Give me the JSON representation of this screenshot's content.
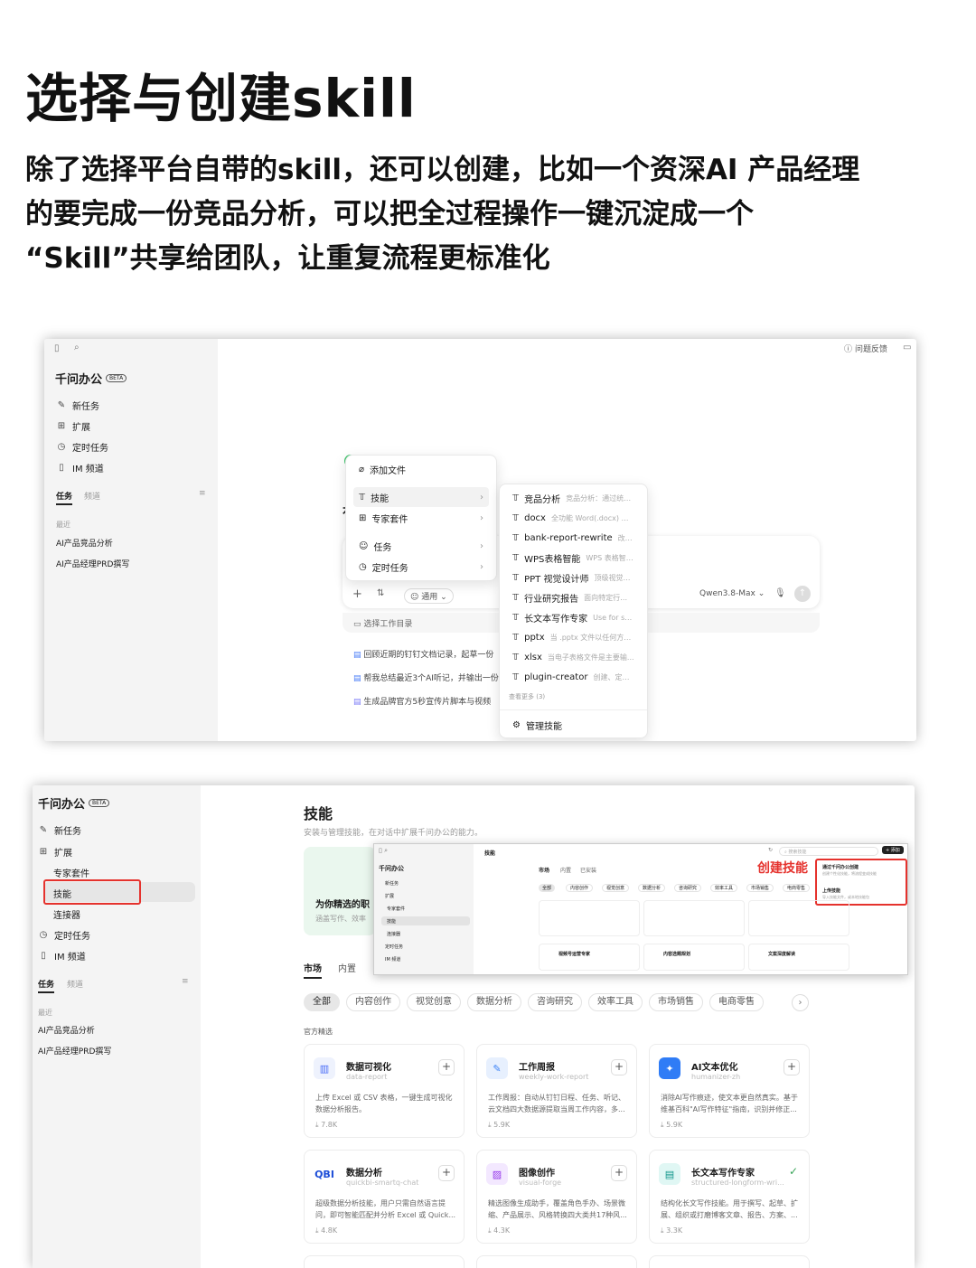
{
  "headline": "选择与创建skill",
  "subtext": [
    "除了选择平台自带的skill，还可以创建，比如一个资深AI 产品经理",
    "的要完成一份竞品分析，可以把全过程操作一键沉淀成一个",
    "“Skill”共享给团队，让重复流程更标准化"
  ],
  "shot1": {
    "brand": "千问办公",
    "beta": "BETA",
    "feedback": "问题反馈",
    "nav": [
      "新任务",
      "扩展",
      "定时任务",
      "IM 频道"
    ],
    "tabs": [
      "任务",
      "频道"
    ],
    "recent_label": "最近",
    "recent": [
      "AI产品竞品分析",
      "AI产品经理PRD撰写"
    ],
    "menu1": [
      "添加文件",
      "技能",
      "专家套件",
      "任务",
      "定时任务"
    ],
    "skills": [
      {
        "name": "竞品分析",
        "desc": "竞品分析：通过统一..."
      },
      {
        "name": "docx",
        "desc": "全功能 Word(.docx) 技..."
      },
      {
        "name": "bank-report-rewrite",
        "desc": "改写银..."
      },
      {
        "name": "WPS表格智能",
        "desc": "WPS 表格智能..."
      },
      {
        "name": "PPT 视觉设计师",
        "desc": "顶级视觉策..."
      },
      {
        "name": "行业研究报告",
        "desc": "面向特定行业/..."
      },
      {
        "name": "长文本写作专家",
        "desc": "Use for stru..."
      },
      {
        "name": "pptx",
        "desc": "当 .pptx 文件以任何方式..."
      },
      {
        "name": "xlsx",
        "desc": "当电子表格文件是主要输..."
      },
      {
        "name": "plugin-creator",
        "desc": "创建、定制或..."
      }
    ],
    "more": "查看更多 (3)",
    "manage": "管理技能",
    "toolbar_general": "通用",
    "model": "Qwen3.8-Max",
    "workdir": "选择工作目录",
    "suggestions": [
      "回顾近期的钉钉文档记录，起草一份",
      "帮我总结最近3个AI听记，并输出一份",
      "生成品牌官方5秒宣传片脚本与视频"
    ]
  },
  "shot2": {
    "brand": "千问办公",
    "beta": "BETA",
    "nav": [
      "新任务",
      "扩展",
      "专家套件",
      "技能",
      "连接器",
      "定时任务",
      "IM 频道"
    ],
    "tabs": [
      "任务",
      "频道"
    ],
    "recent_label": "最近",
    "recent": [
      "AI产品竞品分析",
      "AI产品经理PRD撰写"
    ],
    "title": "技能",
    "subtitle": "安装与管理技能，在对话中扩展千问办公的能力。",
    "banner_title": "为你精选的职",
    "banner_sub": "涵盖写作、效率",
    "market_tabs": [
      "市场",
      "内置"
    ],
    "categories": [
      "全部",
      "内容创作",
      "视觉创意",
      "数据分析",
      "咨询研究",
      "效率工具",
      "市场销售",
      "电商零售"
    ],
    "section": "官方精选",
    "cards": [
      {
        "icon": "chart",
        "title": "数据可视化",
        "slug": "data-report",
        "desc": "上传 Excel 或 CSV 表格，一键生成可视化数据分析报告。",
        "dl": "7.8K",
        "color": "#e9eefc",
        "fg": "#4a6cf7",
        "glyph": "📊"
      },
      {
        "icon": "weekly",
        "title": "工作周报",
        "slug": "weekly-work-report",
        "desc": "工作周报：自动从钉钉日程、任务、听记、云文档四大数据源提取当周工作内容，多...",
        "dl": "5.9K",
        "color": "#e7f0fe",
        "fg": "#3b82f6",
        "glyph": "✎"
      },
      {
        "icon": "ai-write",
        "title": "AI文本优化",
        "slug": "humanizer-zh",
        "desc": "消除AI写作痕迹，使文本更自然真实。基于维基百科\"AI写作特征\"指南，识别并修正...",
        "dl": "5.9K",
        "color": "#e6f0ff",
        "fg": "#2563eb",
        "glyph": "✦"
      },
      {
        "icon": "qbi",
        "title": "数据分析",
        "slug": "quickbi-smartq-chat",
        "desc": "超级数据分析技能，用户只需自然语言提问，即可智能匹配并分析 Excel 或 Quick...",
        "dl": "4.8K",
        "color": "#ffffff",
        "fg": "#1d4ed8",
        "glyph": "QBI"
      },
      {
        "icon": "image",
        "title": "图像创作",
        "slug": "visual-forge",
        "desc": "精选图像生成助手，覆盖角色手办、场景微缩、产品展示、风格转换四大类共17种风...",
        "dl": "4.3K",
        "color": "#f3e8ff",
        "fg": "#9333ea",
        "glyph": "▨"
      },
      {
        "icon": "longform",
        "title": "长文本写作专家",
        "slug": "structured-longform-wri...",
        "desc": "结构化长文写作技能。用于撰写、起草、扩展、组织或打磨博客文章、报告、方案、...",
        "dl": "3.3K",
        "color": "#e0f7f4",
        "fg": "#0d9488",
        "glyph": "▤"
      }
    ],
    "inset": {
      "brand": "千问办公",
      "page": "技能",
      "tabs": [
        "市场",
        "内置",
        "已安装"
      ],
      "nav": [
        "新任务",
        "扩展",
        "专家套件",
        "技能",
        "连接器",
        "定时任务",
        "IM 频道"
      ],
      "create_label": "创建技能",
      "add_btn": "+ 添加",
      "search": "搜索技能",
      "chips": [
        "全部",
        "内容创作",
        "视觉创意",
        "数据分析",
        "咨询研究",
        "效率工具",
        "市场销售",
        "电商零售"
      ],
      "dropdown": [
        {
          "t": "通过千问办公创建",
          "s": "创建个性化技能，将流程变成技能"
        },
        {
          "t": "上传技能",
          "s": "导入技能文件，或本地技能包"
        }
      ],
      "cards": [
        "视频号运营专家",
        "内容选题规划",
        "文案深度解读"
      ]
    }
  }
}
